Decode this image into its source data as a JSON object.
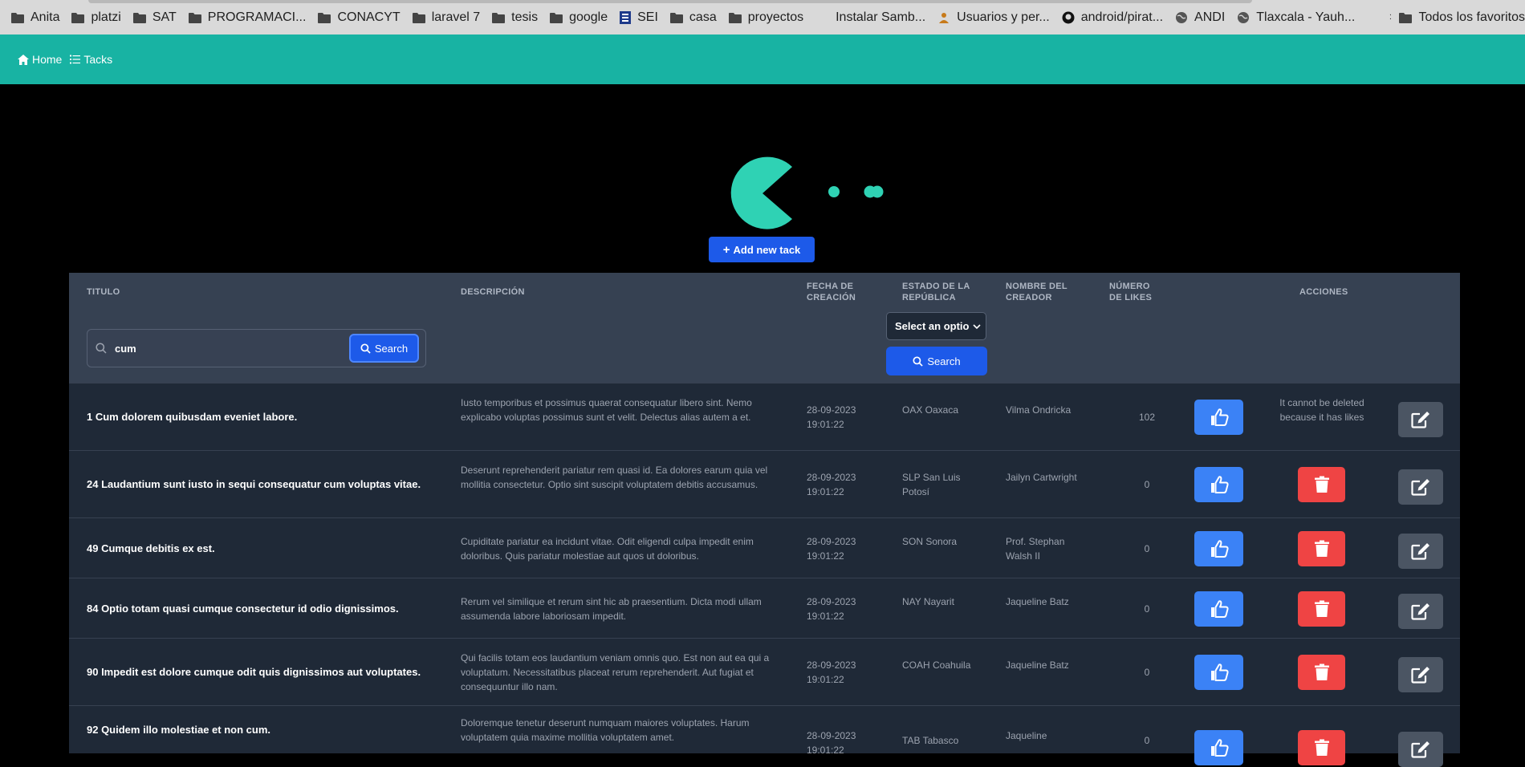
{
  "bookmarks": {
    "items": [
      {
        "label": "Anita",
        "icon": "folder-icon"
      },
      {
        "label": "platzi",
        "icon": "folder-icon"
      },
      {
        "label": "SAT",
        "icon": "folder-icon"
      },
      {
        "label": "PROGRAMACI...",
        "icon": "folder-icon"
      },
      {
        "label": "CONACYT",
        "icon": "folder-icon"
      },
      {
        "label": "laravel 7",
        "icon": "folder-icon"
      },
      {
        "label": "tesis",
        "icon": "folder-icon"
      },
      {
        "label": "google",
        "icon": "folder-icon"
      },
      {
        "label": "SEI",
        "icon": "site-icon"
      },
      {
        "label": "casa",
        "icon": "folder-icon"
      },
      {
        "label": "proyectos",
        "icon": "folder-icon"
      },
      {
        "label": "Instalar Samb...",
        "icon": "none"
      },
      {
        "label": "Usuarios y per...",
        "icon": "person-icon"
      },
      {
        "label": "android/pirat...",
        "icon": "github-icon"
      },
      {
        "label": "ANDI",
        "icon": "globe-icon"
      },
      {
        "label": "Tlaxcala - Yauh...",
        "icon": "globe-icon"
      }
    ],
    "more": "»",
    "all_bookmarks": "Todos los favoritos"
  },
  "nav": {
    "home": "Home",
    "tacks": "Tacks"
  },
  "hero": {
    "add_button": "Add new tack"
  },
  "table": {
    "headers": {
      "titulo": "TITULO",
      "descripcion": "DESCRIPCIÓN",
      "fecha_1": "FECHA DE",
      "fecha_2": "CREACIÓN",
      "estado_1": "ESTADO DE LA",
      "estado_2": "REPÚBLICA",
      "nombre_1": "NOMBRE DEL",
      "nombre_2": "CREADOR",
      "likes_1": "NÚMERO",
      "likes_2": "DE LIKES",
      "acciones": "ACCIONES"
    },
    "search": {
      "value": "cum",
      "button": "Search"
    },
    "state_filter": {
      "selected": "Select an optio",
      "button": "Search"
    },
    "delete_note": "It cannot be deleted because it has likes",
    "rows": [
      {
        "title": "1 Cum dolorem quibusdam eveniet labore.",
        "desc": "Iusto temporibus et possimus quaerat consequatur libero sint. Nemo explicabo voluptas possimus sunt et velit. Delectus alias autem a et.",
        "date": "28-09-2023",
        "time": "19:01:22",
        "state": "OAX Oaxaca",
        "creator": "Vilma Ondricka",
        "likes": "102"
      },
      {
        "title": "24 Laudantium sunt iusto in sequi consequatur cum voluptas vitae.",
        "desc": "Deserunt reprehenderit pariatur rem quasi id. Ea dolores earum quia vel mollitia consectetur. Optio sint suscipit voluptatem debitis accusamus.",
        "date": "28-09-2023",
        "time": "19:01:22",
        "state": "SLP San Luis Potosí",
        "creator": "Jailyn Cartwright",
        "likes": "0"
      },
      {
        "title": "49 Cumque debitis ex est.",
        "desc": "Cupiditate pariatur ea incidunt vitae. Odit eligendi culpa impedit enim doloribus. Quis pariatur molestiae aut quos ut doloribus.",
        "date": "28-09-2023",
        "time": "19:01:22",
        "state": "SON Sonora",
        "creator": "Prof. Stephan Walsh II",
        "likes": "0"
      },
      {
        "title": "84 Optio totam quasi cumque consectetur id odio dignissimos.",
        "desc": "Rerum vel similique et rerum sint hic ab praesentium. Dicta modi ullam assumenda labore laboriosam impedit.",
        "date": "28-09-2023",
        "time": "19:01:22",
        "state": "NAY Nayarit",
        "creator": "Jaqueline Batz",
        "likes": "0"
      },
      {
        "title": "90 Impedit est dolore cumque odit quis dignissimos aut voluptates.",
        "desc": "Qui facilis totam eos laudantium veniam omnis quo. Est non aut ea qui a voluptatum. Necessitatibus placeat rerum reprehenderit. Aut fugiat et consequuntur illo nam.",
        "date": "28-09-2023",
        "time": "19:01:22",
        "state": "COAH Coahuila",
        "creator": "Jaqueline Batz",
        "likes": "0"
      },
      {
        "title": "92 Quidem illo molestiae et non cum.",
        "desc": "Doloremque tenetur deserunt numquam maiores voluptates. Harum voluptatem quia maxime mollitia voluptatem amet.",
        "date": "28-09-2023",
        "time": "19:01:22",
        "state": "TAB Tabasco",
        "creator": "Jaqueline",
        "likes": "0"
      }
    ]
  },
  "colors": {
    "navbar": "#18b3a3",
    "accent_teal": "#2fd2b4",
    "primary": "#1d5ae9",
    "like": "#3b82f6",
    "danger": "#ef4444",
    "edit": "#4b5563"
  }
}
